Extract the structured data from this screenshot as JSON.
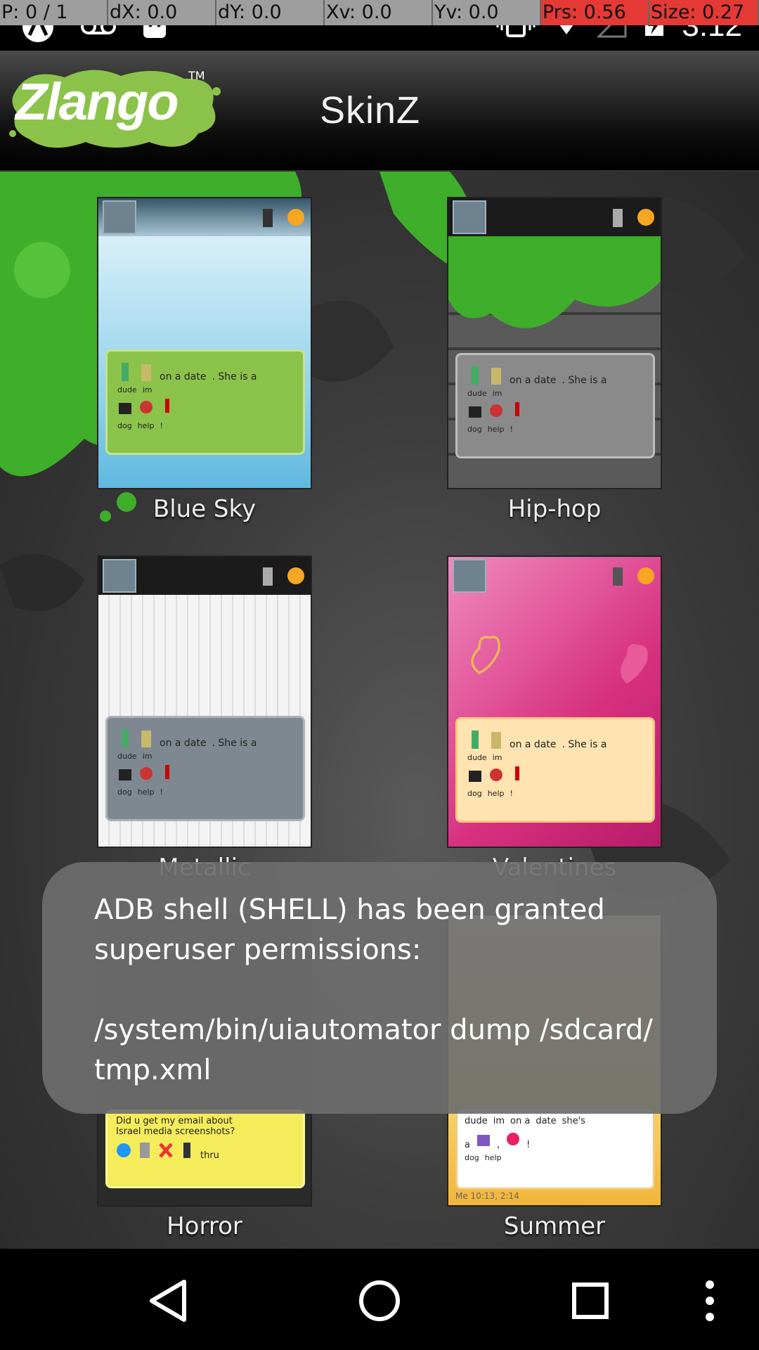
{
  "debug": {
    "p": "P: 0 / 1",
    "dx": "dX: 0.0",
    "dy": "dY: 0.0",
    "xv": "Xv: 0.0",
    "yv": "Yv: 0.0",
    "prs": "Prs: 0.56",
    "size": "Size: 0.27"
  },
  "status": {
    "time": "3:12"
  },
  "header": {
    "logo": "Zlango",
    "logo_tm": "TM",
    "title": "SkinZ"
  },
  "bubble_text": {
    "line1_words": [
      "dude",
      "im",
      "on a date",
      ". She is a"
    ],
    "line2_words": [
      "dog",
      ",",
      "help",
      "!"
    ]
  },
  "horror_bubble_text": {
    "line1": "Did u get my email about",
    "line2": "Israel media screenshots?",
    "line3_words": [
      "email",
      "says",
      "not",
      "going",
      "thru"
    ]
  },
  "summer_bubble_text": {
    "line1_words": [
      "dude",
      "im",
      "on a",
      "date",
      "she's"
    ],
    "line2_words": [
      "a",
      "dog",
      ",",
      "help",
      "!"
    ],
    "timestamp": "Me 10:13, 2:14"
  },
  "skins": [
    {
      "label": "Blue Sky"
    },
    {
      "label": "Hip-hop"
    },
    {
      "label": "Metallic"
    },
    {
      "label": "Valentines"
    },
    {
      "label": "Horror"
    },
    {
      "label": "Summer"
    }
  ],
  "toast": {
    "line1": "ADB shell (SHELL) has been granted",
    "line2": "superuser permissions:",
    "line3": "/system/bin/uiautomator dump /sdcard/",
    "line4": "tmp.xml"
  },
  "colors": {
    "splash_green": "#3fae2a",
    "logo_green": "#8bc34a",
    "toast_bg": "#6e6e6e",
    "debug_hot": "#e53935"
  }
}
